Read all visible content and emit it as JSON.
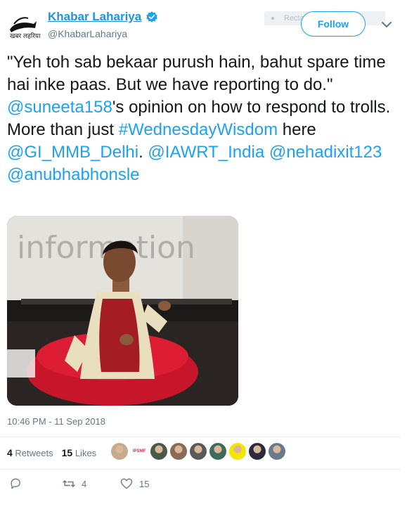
{
  "account": {
    "display_name": "Khabar Lahariya",
    "handle": "@KhabarLahariya",
    "verified": true,
    "avatar_icon": "khabar-lahariya-logo",
    "logo_text": "खबर लहरिया"
  },
  "overlay": {
    "snip_label": "Rectangular Snip"
  },
  "follow_label": "Follow",
  "tweet": {
    "segments": [
      {
        "text": "\"Yeh toh sab bekaar purush hain, bahut spare time hai inke paas. But we have reporting to do.\" ",
        "link": false
      },
      {
        "text": "@suneeta158",
        "link": true
      },
      {
        "text": "'s opinion on how to respond to trolls. More than just ",
        "link": false
      },
      {
        "text": "#WednesdayWisdom",
        "link": true
      },
      {
        "text": " here ",
        "link": false
      },
      {
        "text": "@GI_MMB_Delhi",
        "link": true
      },
      {
        "text": ". ",
        "link": false
      },
      {
        "text": "@IAWRT_India",
        "link": true
      },
      {
        "text": " ",
        "link": false
      },
      {
        "text": "@nehadixit123",
        "link": true
      },
      {
        "text": " ",
        "link": false
      },
      {
        "text": "@anubhabhonsle",
        "link": true
      }
    ],
    "photo_screen_text": "information"
  },
  "timestamp": "10:46 PM - 11 Sep 2018",
  "stats": {
    "retweets_count": "4",
    "retweets_label": "Retweets",
    "likes_count": "15",
    "likes_label": "Likes"
  },
  "likers": [
    {
      "icon": "avatar-1",
      "color": "#c9a98c"
    },
    {
      "icon": "ipsmf-logo",
      "text": "IPSMF"
    },
    {
      "icon": "avatar-3",
      "color": "#4a5a4a"
    },
    {
      "icon": "avatar-4",
      "color": "#8a6a55"
    },
    {
      "icon": "avatar-5",
      "color": "#5a5a5a"
    },
    {
      "icon": "avatar-6",
      "color": "#3f6b5a"
    },
    {
      "icon": "avatar-7",
      "color": "#f5e400"
    },
    {
      "icon": "avatar-8",
      "color": "#2b2b3a"
    },
    {
      "icon": "avatar-9",
      "color": "#6a7a8a"
    }
  ],
  "actions": {
    "reply_icon": "reply-icon",
    "retweet_icon": "retweet-icon",
    "retweet_count": "4",
    "like_icon": "heart-icon",
    "like_count": "15"
  },
  "colors": {
    "link": "#1da1f2",
    "name": "#1b95e0",
    "secondary": "#657786",
    "divider": "#e6ecf0"
  }
}
